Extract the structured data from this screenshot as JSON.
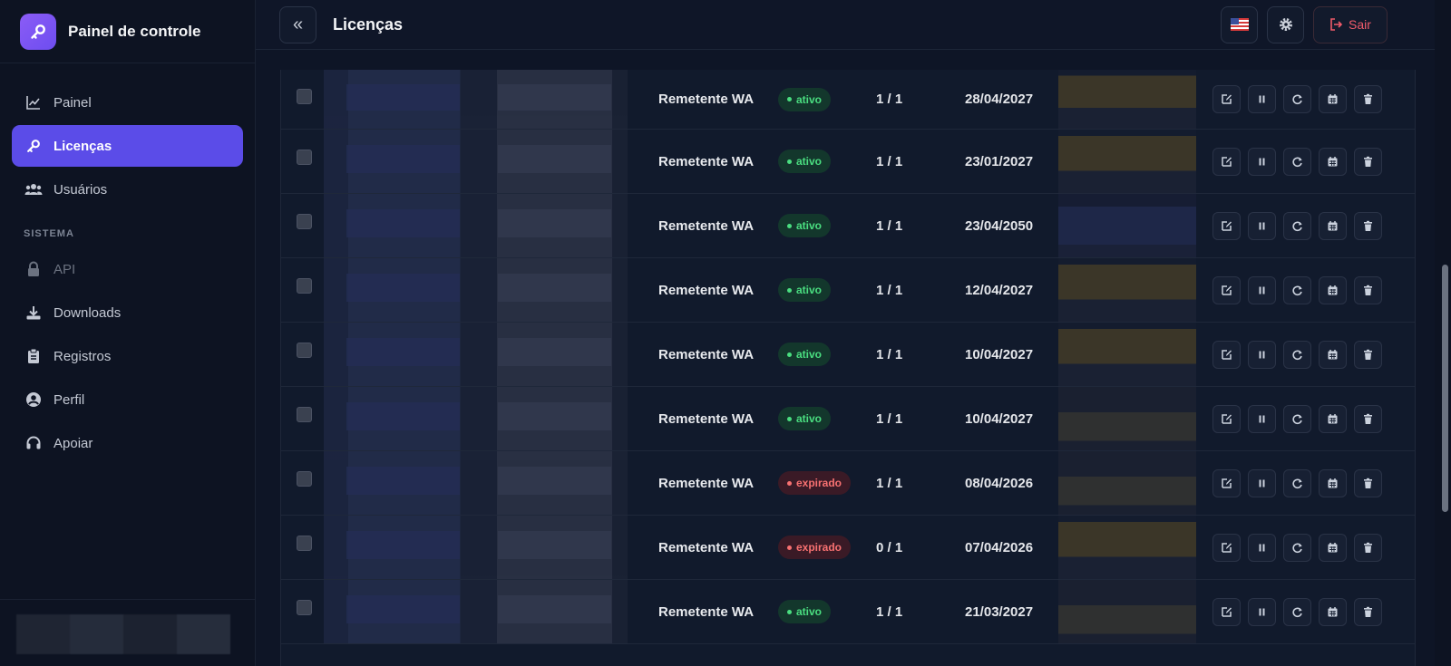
{
  "app": {
    "title": "Painel de controle"
  },
  "sidebar": {
    "items": [
      {
        "label": "Painel",
        "icon": "chart-line-icon",
        "active": false
      },
      {
        "label": "Licenças",
        "icon": "key-icon",
        "active": true
      },
      {
        "label": "Usuários",
        "icon": "users-icon",
        "active": false
      }
    ],
    "section_label": "SISTEMA",
    "system_items": [
      {
        "label": "API",
        "icon": "lock-icon",
        "disabled": true
      },
      {
        "label": "Downloads",
        "icon": "download-icon"
      },
      {
        "label": "Registros",
        "icon": "clipboard-icon"
      },
      {
        "label": "Perfil",
        "icon": "user-circle-icon"
      },
      {
        "label": "Apoiar",
        "icon": "headset-icon"
      }
    ]
  },
  "header": {
    "title": "Licenças",
    "logout_label": "Sair",
    "collapse_symbol": "«"
  },
  "table": {
    "rows": [
      {
        "type": "Remetente WA",
        "status": "ativo",
        "devices": "1 / 1",
        "expiry": "28/04/2027"
      },
      {
        "type": "Remetente WA",
        "status": "ativo",
        "devices": "1 / 1",
        "expiry": "23/01/2027"
      },
      {
        "type": "Remetente WA",
        "status": "ativo",
        "devices": "1 / 1",
        "expiry": "23/04/2050"
      },
      {
        "type": "Remetente WA",
        "status": "ativo",
        "devices": "1 / 1",
        "expiry": "12/04/2027"
      },
      {
        "type": "Remetente WA",
        "status": "ativo",
        "devices": "1 / 1",
        "expiry": "10/04/2027"
      },
      {
        "type": "Remetente WA",
        "status": "ativo",
        "devices": "1 / 1",
        "expiry": "10/04/2027"
      },
      {
        "type": "Remetente WA",
        "status": "expirado",
        "devices": "1 / 1",
        "expiry": "08/04/2026"
      },
      {
        "type": "Remetente WA",
        "status": "expirado",
        "devices": "0 / 1",
        "expiry": "07/04/2026"
      },
      {
        "type": "Remetente WA",
        "status": "ativo",
        "devices": "1 / 1",
        "expiry": "21/03/2027"
      }
    ]
  },
  "colors": {
    "accent": "#5b4ce8",
    "active_badge": "#4ade80",
    "expired_badge": "#f87171",
    "logout": "#f05b6a"
  }
}
